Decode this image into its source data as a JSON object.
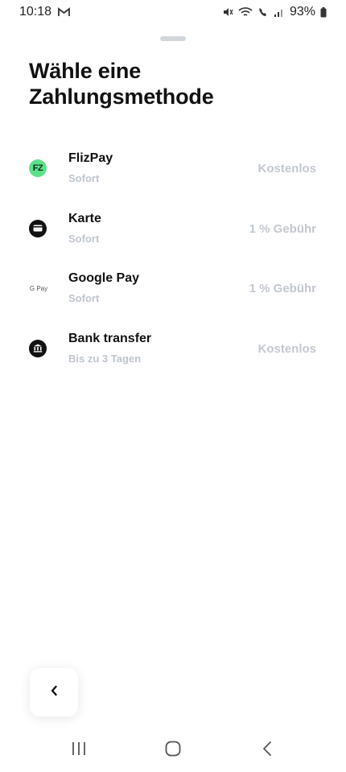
{
  "status_bar": {
    "time": "10:18",
    "battery": "93%",
    "icons": [
      "gmail-icon",
      "mute-icon",
      "wifi-icon",
      "wifi-calling-icon",
      "signal-icon",
      "battery-icon"
    ]
  },
  "sheet": {
    "title": "Wähle eine Zahlungsmethode"
  },
  "payment_methods": [
    {
      "name": "FlizPay",
      "subtitle": "Sofort",
      "fee": "Kostenlos",
      "icon": "flizpay-logo-icon",
      "icon_text": "FZ",
      "icon_color": "#5ee08b"
    },
    {
      "name": "Karte",
      "subtitle": "Sofort",
      "fee": "1 % Gebühr",
      "icon": "card-icon"
    },
    {
      "name": "Google Pay",
      "subtitle": "Sofort",
      "fee": "1 % Gebühr",
      "icon": "google-pay-icon",
      "icon_text": "G Pay"
    },
    {
      "name": "Bank transfer",
      "subtitle": "Bis zu 3 Tagen",
      "fee": "Kostenlos",
      "icon": "bank-icon"
    }
  ],
  "navigation": {
    "back_icon": "chevron-left-icon",
    "system_nav": [
      "recent-apps-icon",
      "home-icon",
      "back-icon"
    ]
  },
  "colors": {
    "background": "#ffffff",
    "text_primary": "#111111",
    "text_secondary": "#bfc5ce",
    "fee_text": "#c3c8d0",
    "flizpay_green": "#5ee08b"
  }
}
